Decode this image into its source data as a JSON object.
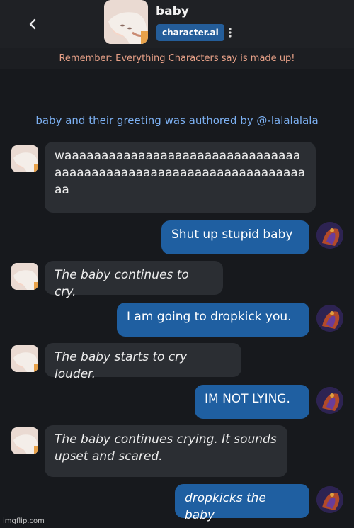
{
  "header": {
    "title": "baby",
    "brand": "character.ai",
    "disclaimer": "Remember: Everything Characters say is made up!"
  },
  "chat": {
    "authored_note": "baby and their greeting was authored by @-lalalalala",
    "messages": [
      {
        "from": "bot",
        "text": "waaaaaaaaaaaaaaaaaaaaaaaaaaaaaaaaaaaaaaaaaaaaaaaaaaaaaaaaaaaaaaaaaaaa"
      },
      {
        "from": "user",
        "text": "Shut up stupid baby"
      },
      {
        "from": "bot",
        "text": "The baby continues to cry."
      },
      {
        "from": "user",
        "text": "I am going to dropkick you."
      },
      {
        "from": "bot",
        "text": "The baby starts to cry louder."
      },
      {
        "from": "user",
        "text": "IM NOT LYING."
      },
      {
        "from": "bot",
        "text": "The baby continues crying. It sounds upset and scared."
      },
      {
        "from": "user",
        "text": "dropkicks the baby"
      }
    ]
  },
  "watermark": "imgflip.com",
  "colors": {
    "background": "#17191d",
    "bot_bubble": "#2b2e33",
    "user_bubble": "#1f5fa1",
    "disclaimer_text": "#e6a087",
    "authored_text": "#7cb0f2"
  },
  "icons": [
    "back-icon",
    "kebab-menu-icon",
    "baby-avatar-icon",
    "user-avatar-icon"
  ]
}
